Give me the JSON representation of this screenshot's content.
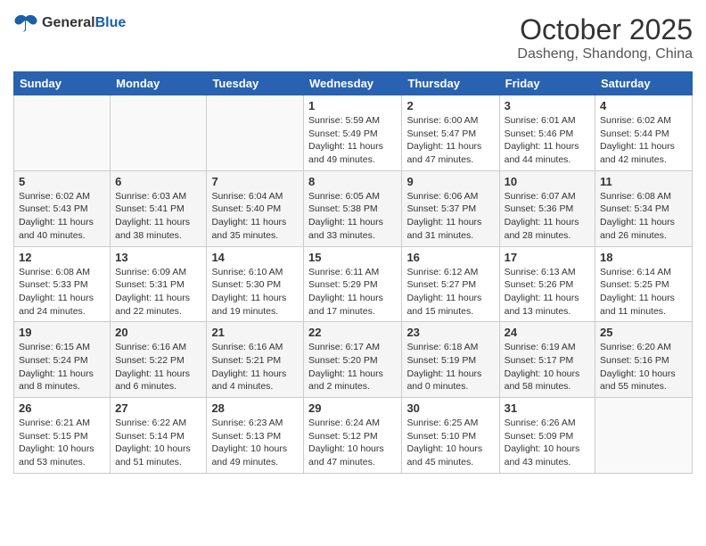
{
  "header": {
    "logo": {
      "general": "General",
      "blue": "Blue"
    },
    "month": "October 2025",
    "location": "Dasheng, Shandong, China"
  },
  "weekdays": [
    "Sunday",
    "Monday",
    "Tuesday",
    "Wednesday",
    "Thursday",
    "Friday",
    "Saturday"
  ],
  "weeks": [
    [
      {
        "day": "",
        "info": ""
      },
      {
        "day": "",
        "info": ""
      },
      {
        "day": "",
        "info": ""
      },
      {
        "day": "1",
        "info": "Sunrise: 5:59 AM\nSunset: 5:49 PM\nDaylight: 11 hours\nand 49 minutes."
      },
      {
        "day": "2",
        "info": "Sunrise: 6:00 AM\nSunset: 5:47 PM\nDaylight: 11 hours\nand 47 minutes."
      },
      {
        "day": "3",
        "info": "Sunrise: 6:01 AM\nSunset: 5:46 PM\nDaylight: 11 hours\nand 44 minutes."
      },
      {
        "day": "4",
        "info": "Sunrise: 6:02 AM\nSunset: 5:44 PM\nDaylight: 11 hours\nand 42 minutes."
      }
    ],
    [
      {
        "day": "5",
        "info": "Sunrise: 6:02 AM\nSunset: 5:43 PM\nDaylight: 11 hours\nand 40 minutes."
      },
      {
        "day": "6",
        "info": "Sunrise: 6:03 AM\nSunset: 5:41 PM\nDaylight: 11 hours\nand 38 minutes."
      },
      {
        "day": "7",
        "info": "Sunrise: 6:04 AM\nSunset: 5:40 PM\nDaylight: 11 hours\nand 35 minutes."
      },
      {
        "day": "8",
        "info": "Sunrise: 6:05 AM\nSunset: 5:38 PM\nDaylight: 11 hours\nand 33 minutes."
      },
      {
        "day": "9",
        "info": "Sunrise: 6:06 AM\nSunset: 5:37 PM\nDaylight: 11 hours\nand 31 minutes."
      },
      {
        "day": "10",
        "info": "Sunrise: 6:07 AM\nSunset: 5:36 PM\nDaylight: 11 hours\nand 28 minutes."
      },
      {
        "day": "11",
        "info": "Sunrise: 6:08 AM\nSunset: 5:34 PM\nDaylight: 11 hours\nand 26 minutes."
      }
    ],
    [
      {
        "day": "12",
        "info": "Sunrise: 6:08 AM\nSunset: 5:33 PM\nDaylight: 11 hours\nand 24 minutes."
      },
      {
        "day": "13",
        "info": "Sunrise: 6:09 AM\nSunset: 5:31 PM\nDaylight: 11 hours\nand 22 minutes."
      },
      {
        "day": "14",
        "info": "Sunrise: 6:10 AM\nSunset: 5:30 PM\nDaylight: 11 hours\nand 19 minutes."
      },
      {
        "day": "15",
        "info": "Sunrise: 6:11 AM\nSunset: 5:29 PM\nDaylight: 11 hours\nand 17 minutes."
      },
      {
        "day": "16",
        "info": "Sunrise: 6:12 AM\nSunset: 5:27 PM\nDaylight: 11 hours\nand 15 minutes."
      },
      {
        "day": "17",
        "info": "Sunrise: 6:13 AM\nSunset: 5:26 PM\nDaylight: 11 hours\nand 13 minutes."
      },
      {
        "day": "18",
        "info": "Sunrise: 6:14 AM\nSunset: 5:25 PM\nDaylight: 11 hours\nand 11 minutes."
      }
    ],
    [
      {
        "day": "19",
        "info": "Sunrise: 6:15 AM\nSunset: 5:24 PM\nDaylight: 11 hours\nand 8 minutes."
      },
      {
        "day": "20",
        "info": "Sunrise: 6:16 AM\nSunset: 5:22 PM\nDaylight: 11 hours\nand 6 minutes."
      },
      {
        "day": "21",
        "info": "Sunrise: 6:16 AM\nSunset: 5:21 PM\nDaylight: 11 hours\nand 4 minutes."
      },
      {
        "day": "22",
        "info": "Sunrise: 6:17 AM\nSunset: 5:20 PM\nDaylight: 11 hours\nand 2 minutes."
      },
      {
        "day": "23",
        "info": "Sunrise: 6:18 AM\nSunset: 5:19 PM\nDaylight: 11 hours\nand 0 minutes."
      },
      {
        "day": "24",
        "info": "Sunrise: 6:19 AM\nSunset: 5:17 PM\nDaylight: 10 hours\nand 58 minutes."
      },
      {
        "day": "25",
        "info": "Sunrise: 6:20 AM\nSunset: 5:16 PM\nDaylight: 10 hours\nand 55 minutes."
      }
    ],
    [
      {
        "day": "26",
        "info": "Sunrise: 6:21 AM\nSunset: 5:15 PM\nDaylight: 10 hours\nand 53 minutes."
      },
      {
        "day": "27",
        "info": "Sunrise: 6:22 AM\nSunset: 5:14 PM\nDaylight: 10 hours\nand 51 minutes."
      },
      {
        "day": "28",
        "info": "Sunrise: 6:23 AM\nSunset: 5:13 PM\nDaylight: 10 hours\nand 49 minutes."
      },
      {
        "day": "29",
        "info": "Sunrise: 6:24 AM\nSunset: 5:12 PM\nDaylight: 10 hours\nand 47 minutes."
      },
      {
        "day": "30",
        "info": "Sunrise: 6:25 AM\nSunset: 5:10 PM\nDaylight: 10 hours\nand 45 minutes."
      },
      {
        "day": "31",
        "info": "Sunrise: 6:26 AM\nSunset: 5:09 PM\nDaylight: 10 hours\nand 43 minutes."
      },
      {
        "day": "",
        "info": ""
      }
    ]
  ]
}
